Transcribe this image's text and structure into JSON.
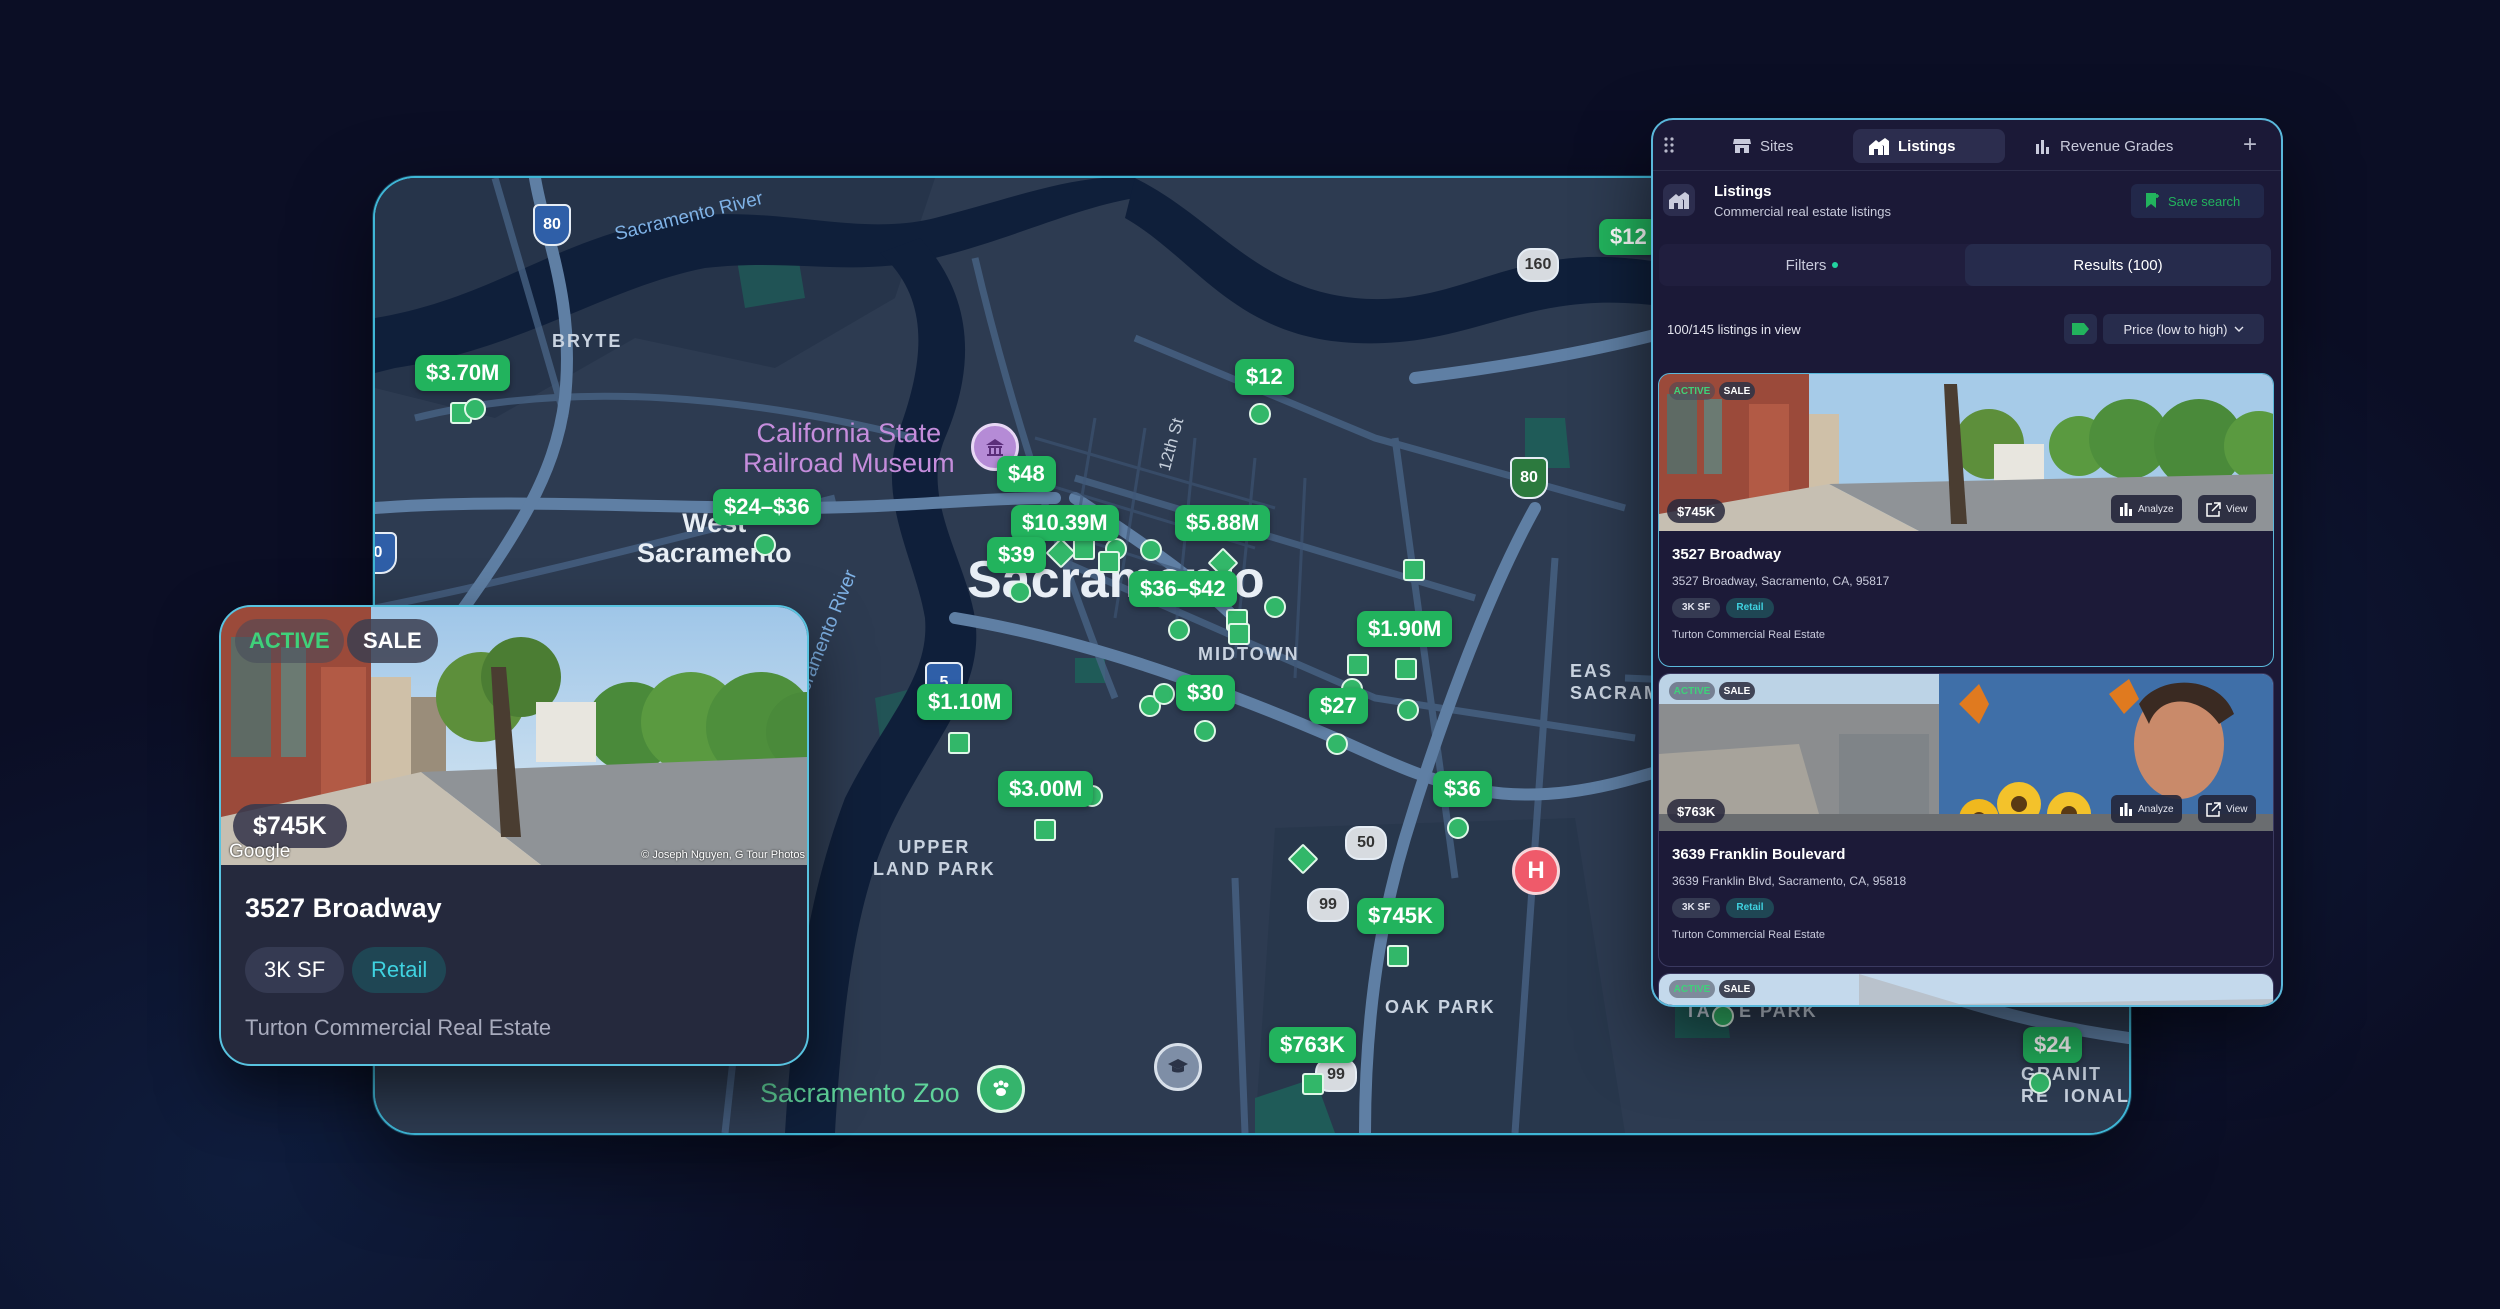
{
  "map": {
    "river_labels": [
      "Sacramento River",
      "Sacramento River"
    ],
    "area_labels": {
      "bryte": "BRYTE",
      "midtown": "MIDTOWN",
      "upper_land_park": "UPPER\nLAND PARK",
      "oak_park": "OAK PARK",
      "east_sac": "EAS\nSACRAM",
      "granite": "GRANIT\nRE  IONAL",
      "tahoe_park": "TA    E PARK"
    },
    "city_labels": {
      "west_sac": "West\nSacramento",
      "sacramento": "Sacramento"
    },
    "poi_labels": {
      "railroad_museum": "California State\nRailroad Museum",
      "zoo": "Sacramento Zoo"
    },
    "street_labels": {
      "twelfth": "12th St"
    },
    "shields": [
      "80",
      "160",
      "80",
      "5",
      "50",
      "99",
      "99",
      "80",
      "0"
    ],
    "price_tags": [
      "$3.70M",
      "$24–$36",
      "$48",
      "$10.39M",
      "$39",
      "$5.88M",
      "$36–$42",
      "$12",
      "$12",
      "$1.90M",
      "$1.10M",
      "$30",
      "$27",
      "$3.00M",
      "$36",
      "$745K",
      "$763K",
      "$24"
    ],
    "hospital_letter": "H"
  },
  "featured": {
    "status": "ACTIVE",
    "type": "SALE",
    "price": "$745K",
    "google": "Google",
    "photo_credit": "© Joseph Nguyen, G Tour Photos",
    "title": "3527 Broadway",
    "size": "3K SF",
    "category": "Retail",
    "broker": "Turton Commercial Real Estate"
  },
  "panel": {
    "tabs": [
      "Sites",
      "Listings",
      "Revenue Grades"
    ],
    "active_tab": "Listings",
    "header_title": "Listings",
    "header_subtitle": "Commercial real estate listings",
    "save_search": "Save search",
    "filters_label": "Filters",
    "results_label": "Results (100)",
    "in_view": "100/145 listings in view",
    "sort_label": "Price (low to high)",
    "listings": [
      {
        "status": "ACTIVE",
        "type": "SALE",
        "price": "$745K",
        "analyze": "Analyze",
        "view": "View",
        "title": "3527 Broadway",
        "address": "3527 Broadway, Sacramento, CA, 95817",
        "size": "3K SF",
        "category": "Retail",
        "broker": "Turton Commercial Real Estate"
      },
      {
        "status": "ACTIVE",
        "type": "SALE",
        "price": "$763K",
        "analyze": "Analyze",
        "view": "View",
        "title": "3639 Franklin Boulevard",
        "address": "3639 Franklin Blvd, Sacramento, CA, 95818",
        "size": "3K SF",
        "category": "Retail",
        "broker": "Turton Commercial Real Estate"
      },
      {
        "status": "ACTIVE",
        "type": "SALE"
      }
    ]
  },
  "colors": {
    "accent_green": "#22b35d",
    "panel_bg": "#1b1937",
    "border_cyan": "#5ab8db",
    "retail_teal": "#3fd2e0"
  }
}
